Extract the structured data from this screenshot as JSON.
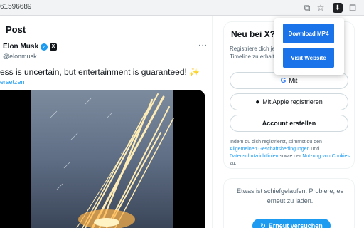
{
  "browser": {
    "url_fragment": "61596689"
  },
  "post": {
    "heading": "Post",
    "author_name": "Elon Musk",
    "author_handle": "@elonmusk",
    "more_label": "···",
    "text": "ess is uncertain, but entertainment is guaranteed!",
    "emoji": "✨",
    "translate_label": "ersetzen"
  },
  "sidebar": {
    "title": "Neu bei X?",
    "subtitle": "Registriere dich jetzt Timeline zu erhalte",
    "google_label": "Mit",
    "apple_label": "Mit Apple registrieren",
    "create_label": "Account erstellen",
    "terms_prefix": "Indem du dich registrierst, stimmst du den",
    "terms_link1": "Allgemeinen Geschäftsbedingungen",
    "terms_and": "und",
    "terms_link2": "Datenschutzrichtlinien",
    "terms_middle": "sowie der",
    "terms_link3": "Nutzung von Cookies",
    "terms_suffix": "zu.",
    "error_text": "Etwas ist schiefgelaufen. Probiere, es erneut zu laden.",
    "retry_label": "Erneut versuchen"
  },
  "popup": {
    "download_label": "Download MP4",
    "visit_label": "Visit Website"
  },
  "colors": {
    "accent": "#1d9bf0",
    "popup_button": "#1a73e8"
  }
}
